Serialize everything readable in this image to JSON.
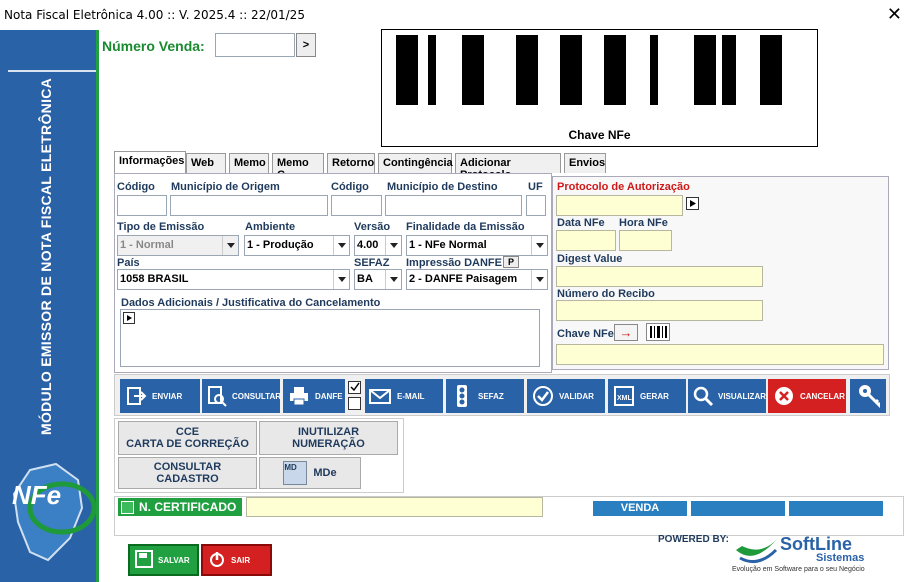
{
  "window": {
    "title": "Nota Fiscal Eletrônica 4.00 :: V. 2025.4 :: 22/01/25",
    "close_glyph": "✕"
  },
  "sidebar": {
    "vertical_text": "MÓDULO EMISSOR DE NOTA FISCAL ELETRÔNICA",
    "logo_text": "NFe"
  },
  "header": {
    "numero_venda_label": "Número Venda:",
    "numero_venda_value": "",
    "go_glyph": ">",
    "barcode_caption": "Chave NFe"
  },
  "tabs": [
    {
      "label": "Informações"
    },
    {
      "label": "Web"
    },
    {
      "label": "Memo"
    },
    {
      "label": "Memo C."
    },
    {
      "label": "Retorno"
    },
    {
      "label": "Contingência"
    },
    {
      "label": "Adicionar Protocolo"
    },
    {
      "label": "Envios"
    }
  ],
  "form": {
    "codigo_label": "Código",
    "municipio_origem_label": "Município de Origem",
    "codigo2_label": "Código",
    "municipio_destino_label": "Município de Destino",
    "uf_label": "UF",
    "tipo_emissao_label": "Tipo de Emissão",
    "tipo_emissao_value": "1 - Normal",
    "ambiente_label": "Ambiente",
    "ambiente_value": "1 - Produção",
    "versao_label": "Versão",
    "versao_value": "4.00",
    "finalidade_label": "Finalidade da Emissão",
    "finalidade_value": "1 - NFe Normal",
    "pais_label": "País",
    "pais_value": "1058 BRASIL",
    "sefaz_label": "SEFAZ",
    "sefaz_value": "BA",
    "impressao_label": "Impressão DANFE",
    "impressao_p": "P",
    "impressao_value": "2 - DANFE Paisagem",
    "dados_label": "Dados Adicionais / Justificativa do Cancelamento"
  },
  "right": {
    "protocolo_label": "Protocolo de Autorização",
    "data_label": "Data NFe",
    "hora_label": "Hora NFe",
    "digest_label": "Digest Value",
    "recibo_label": "Número do Recibo",
    "chave_label": "Chave NFe",
    "arrow": "→"
  },
  "actions": [
    {
      "label": "ENVIAR"
    },
    {
      "label": "CONSULTAR"
    },
    {
      "label": "DANFE"
    },
    {
      "label": "E-MAIL"
    },
    {
      "label": "SEFAZ"
    },
    {
      "label": "VALIDAR"
    },
    {
      "label": "GERAR"
    },
    {
      "label": "VISUALIZAR"
    },
    {
      "label": "CANCELAR"
    }
  ],
  "grid_buttons": {
    "cce1": "CCE",
    "cce2": "CARTA DE CORREÇÃO",
    "inut1": "INUTILIZAR",
    "inut2": "NUMERAÇÃO",
    "cons1": "CONSULTAR",
    "cons2": "CADASTRO",
    "mde": "MDe",
    "mde_badge": "MD"
  },
  "cert": {
    "label": "N. CERTIFICADO"
  },
  "status": {
    "venda": "VENDA"
  },
  "footer": {
    "salvar": "SALVAR",
    "sair": "SAIR",
    "powered": "POWERED BY:",
    "brand": "SoftLine",
    "brand2": "Sistemas",
    "tagline": "Evolução em Software para o seu Negócio"
  },
  "colors": {
    "blue": "#2a62a8",
    "green": "#20a040",
    "red": "#d42020",
    "yellow": "#ffffd4"
  }
}
